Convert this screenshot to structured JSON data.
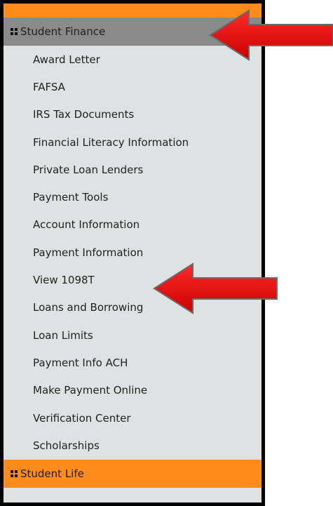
{
  "sidebar": {
    "active_section": "Student Finance",
    "items": [
      "Award Letter",
      "FAFSA",
      "IRS Tax Documents",
      "Financial Literacy Information",
      "Private Loan Lenders",
      "Payment Tools",
      "Account Information",
      "Payment Information",
      "View 1098T",
      "Loans and Borrowing",
      "Loan Limits",
      "Payment Info ACH",
      "Make Payment Online",
      "Verification Center",
      "Scholarships"
    ],
    "next_section": "Student Life"
  },
  "colors": {
    "accent_orange": "#ff8c1a",
    "active_header_gray": "#8a8a8a",
    "menu_background": "#dfe2e2",
    "annotation_red": "#ff0000"
  },
  "icons": {
    "section_icon": "grid-icon",
    "annotation": "red-arrow-icon"
  }
}
